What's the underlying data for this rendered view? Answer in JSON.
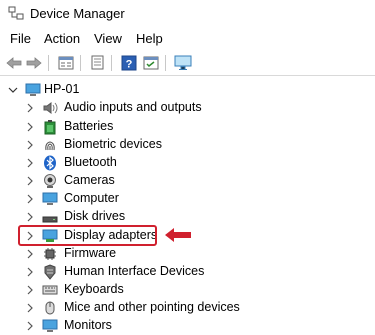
{
  "window": {
    "title": "Device Manager",
    "icon": "device-manager-icon"
  },
  "menu": {
    "items": [
      "File",
      "Action",
      "View",
      "Help"
    ]
  },
  "toolbar": {
    "buttons": [
      "back-arrow-icon",
      "forward-arrow-icon",
      "properties-icon",
      "document-icon",
      "help-icon",
      "update-driver-icon",
      "computer-monitor-icon"
    ]
  },
  "tree": {
    "root": {
      "label": "HP-01",
      "icon": "computer-icon",
      "expanded": true
    },
    "nodes": [
      {
        "label": "Audio inputs and outputs",
        "icon": "speaker-icon"
      },
      {
        "label": "Batteries",
        "icon": "battery-icon"
      },
      {
        "label": "Biometric devices",
        "icon": "fingerprint-icon"
      },
      {
        "label": "Bluetooth",
        "icon": "bluetooth-icon"
      },
      {
        "label": "Cameras",
        "icon": "camera-icon"
      },
      {
        "label": "Computer",
        "icon": "monitor-icon"
      },
      {
        "label": "Disk drives",
        "icon": "disk-drive-icon"
      },
      {
        "label": "Display adapters",
        "icon": "display-adapter-icon",
        "highlighted": true
      },
      {
        "label": "Firmware",
        "icon": "chip-icon"
      },
      {
        "label": "Human Interface Devices",
        "icon": "hid-icon"
      },
      {
        "label": "Keyboards",
        "icon": "keyboard-icon"
      },
      {
        "label": "Mice and other pointing devices",
        "icon": "mouse-icon"
      },
      {
        "label": "Monitors",
        "icon": "monitor-icon"
      }
    ]
  },
  "annotation": {
    "highlight_color": "#d0202e",
    "arrow_icon": "left-arrow-icon"
  }
}
